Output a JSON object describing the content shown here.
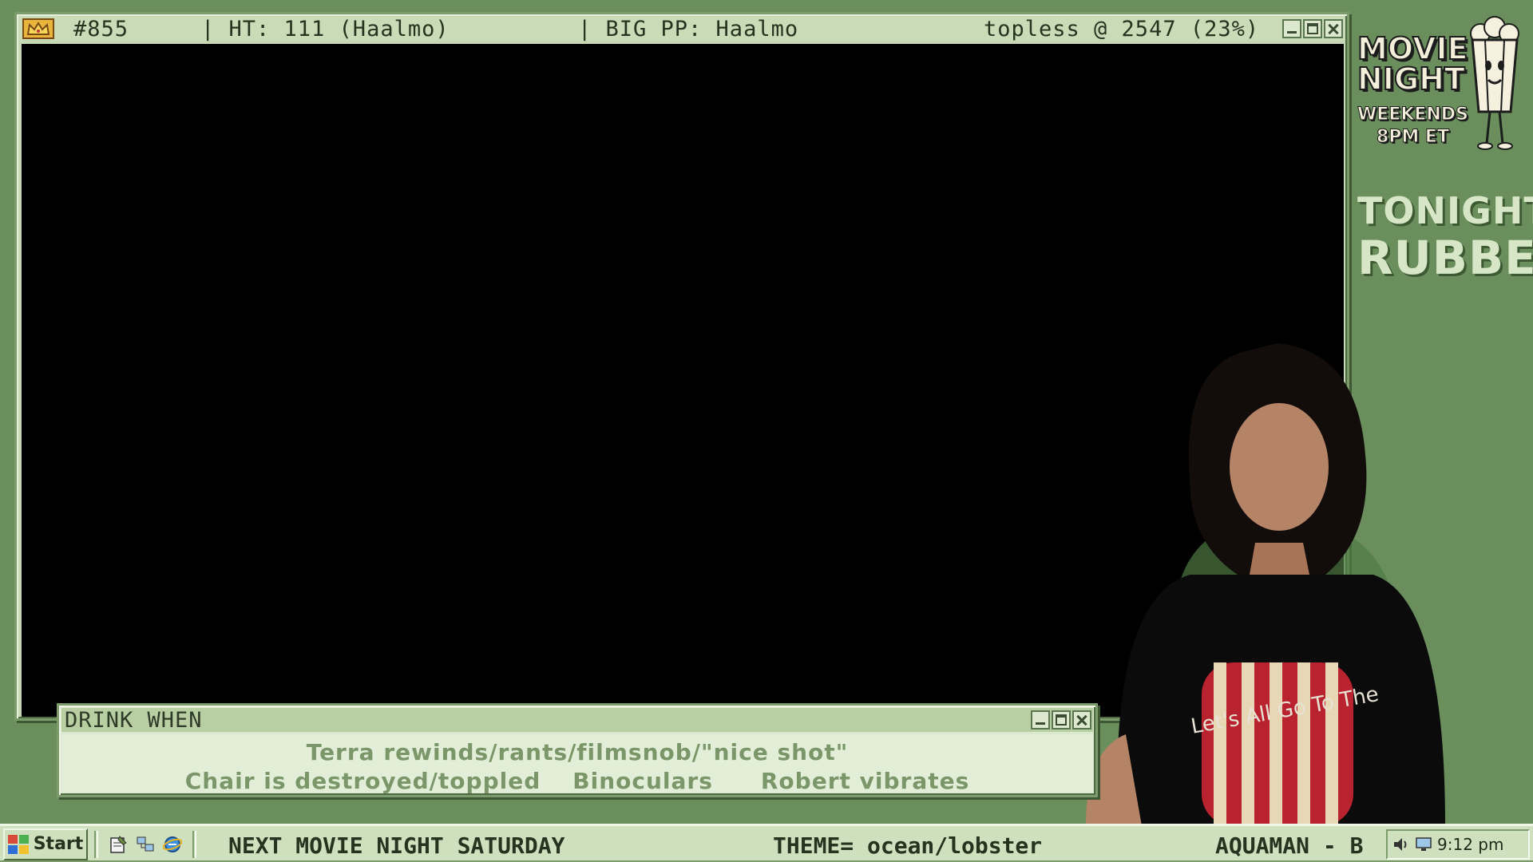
{
  "main_window": {
    "title_id": "#855",
    "title_ht": "| HT: 111 (Haalmo)",
    "title_bigpp": "| BIG PP: Haalmo",
    "title_stat": "topless @  2547 (23%)"
  },
  "sidebar": {
    "promo_title": "MOVIE\nNIGHT",
    "promo_line1": "WEEKENDS",
    "promo_line2": "8PM ET",
    "tonight_label": "TONIGHT:",
    "tonight_movie": "RUBBER"
  },
  "drink_window": {
    "title": "DRINK WHEN",
    "rule1": "Terra rewinds/rants/filmsnob/\"nice shot\"",
    "rule2": "Chair is destroyed/toppled",
    "rule3": "Binoculars",
    "rule4": "Robert vibrates"
  },
  "webcam": {
    "shirt_text": "Let's All Go To The"
  },
  "taskbar": {
    "start_label": "Start",
    "ticker1": "NEXT MOVIE NIGHT SATURDAY",
    "ticker2": "THEME= ocean/lobster",
    "ticker3": "AQUAMAN  - B",
    "clock": "9:12 pm"
  },
  "colors": {
    "background": "#6a8f5c",
    "window_face": "#c6d9b4",
    "video": "#000000",
    "drink_text": "#7b9669"
  },
  "icons": [
    "crown-icon",
    "minimize-icon",
    "maximize-icon",
    "close-icon",
    "windows-logo-icon",
    "notepad-icon",
    "network-icon",
    "internet-explorer-icon",
    "speaker-icon",
    "monitor-icon",
    "popcorn-mascot-icon"
  ]
}
